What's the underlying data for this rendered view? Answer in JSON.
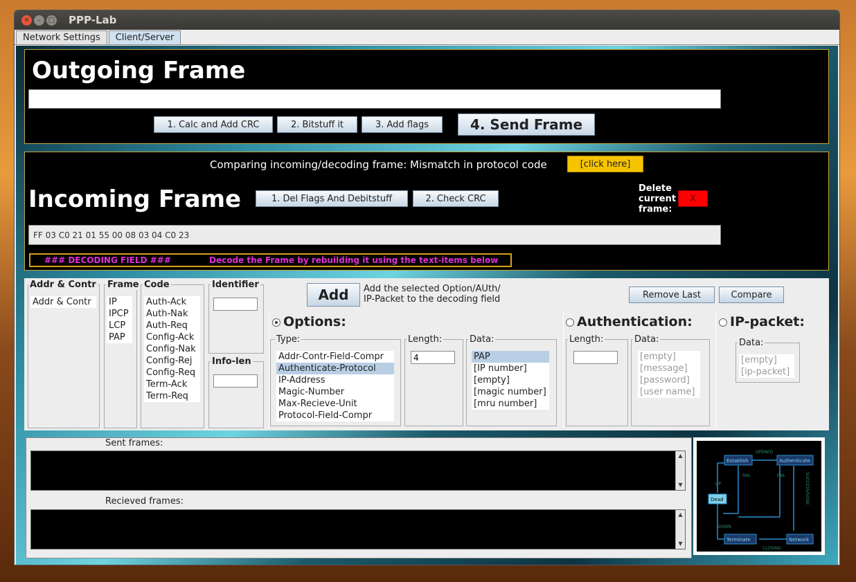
{
  "window": {
    "title": "PPP-Lab"
  },
  "tabs": [
    "Network Settings",
    "Client/Server"
  ],
  "outgoing": {
    "title": "Outgoing Frame",
    "frame_value": "",
    "buttons": [
      "1. Calc and Add CRC",
      "2. Bitstuff it",
      "3. Add flags",
      "4. Send Frame"
    ]
  },
  "incoming": {
    "compare_text": "Comparing incoming/decoding frame: Mismatch in protocol code",
    "click_here": "[click here]",
    "title": "Incoming Frame",
    "buttons": [
      "1. Del Flags And Debitstuff",
      "2. Check CRC"
    ],
    "delete_label_1": "Delete",
    "delete_label_2": "current",
    "delete_label_3": "frame:",
    "delete_button": "X",
    "frame_value": "FF 03 C0 21 01 55 00 08 03 04 C0 23",
    "decoding_label": "###  DECODING FIELD ###",
    "decoding_hint": "Decode the Frame by rebuilding it using the text-items below"
  },
  "builder": {
    "addr_title": "Addr & Contr",
    "addr_items": [
      "Addr & Contr"
    ],
    "frame_title": "Frame",
    "frame_items": [
      "IP",
      "IPCP",
      "LCP",
      "PAP"
    ],
    "code_title": "Code",
    "code_items": [
      "Auth-Ack",
      "Auth-Nak",
      "Auth-Req",
      "Config-Ack",
      "Config-Nak",
      "Config-Rej",
      "Config-Req",
      "Term-Ack",
      "Term-Req"
    ],
    "identifier_title": "Identifier",
    "infolen_title": "Info-len",
    "add_button": "Add",
    "add_desc_1": "Add the selected Option/AUth/",
    "add_desc_2": "IP-Packet to the decoding field",
    "remove_last": "Remove Last",
    "compare": "Compare",
    "options": {
      "title": "Options:",
      "type_label": "Type:",
      "types": [
        "Addr-Contr-Field-Compr",
        "Authenticate-Protocol",
        "IP-Address",
        "Magic-Number",
        "Max-Recieve-Unit",
        "Protocol-Field-Compr"
      ],
      "length_label": "Length:",
      "length_value": "4",
      "data_label": "Data:",
      "data": [
        "PAP",
        "[IP number]",
        "[empty]",
        "[magic number]",
        "[mru number]"
      ]
    },
    "auth": {
      "title": "Authentication:",
      "length_label": "Length:",
      "data_label": "Data:",
      "data": [
        "[empty]",
        "[message]",
        "[password]",
        "[user name]"
      ]
    },
    "ip": {
      "title": "IP-packet:",
      "data_label": "Data:",
      "data": [
        "[empty]",
        "[ip-packet]"
      ]
    }
  },
  "log": {
    "sent_label": "Sent frames:",
    "recv_label": "Recieved frames:"
  },
  "diagram": {
    "states": [
      "Establish",
      "Authenticate",
      "Dead",
      "Terminate",
      "Network"
    ],
    "edges": [
      "OPENED",
      "FAIL",
      "FAIL",
      "UP",
      "SUCCESS/NONE",
      "DOWN",
      "CLOSING"
    ]
  }
}
